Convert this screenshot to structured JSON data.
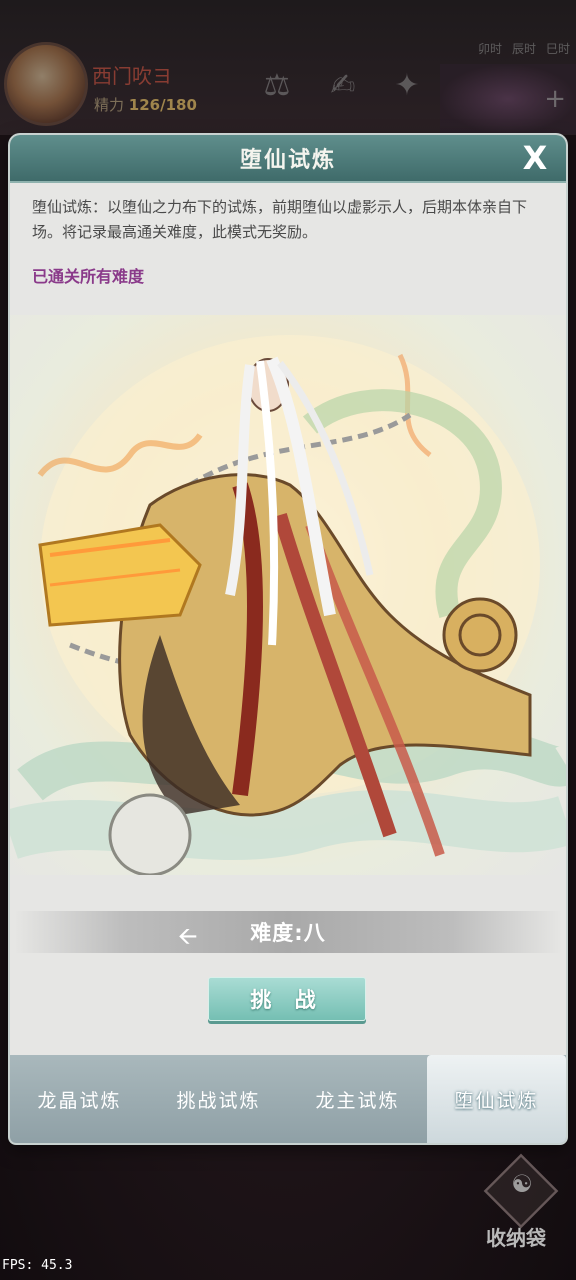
{
  "hud": {
    "player_name": "西门吹ヨ",
    "energy_label": "精力",
    "energy_value": "126/180",
    "time_tabs": [
      "卯时",
      "辰时",
      "巳时"
    ],
    "icons": [
      "bell-icon",
      "scroll-icon",
      "book-icon"
    ]
  },
  "modal": {
    "title": "堕仙试炼",
    "close_symbol": "X",
    "description": "堕仙试炼：以堕仙之力布下的试炼，前期堕仙以虚影示人，后期本体亲自下场。将记录最高通关难度，此模式无奖励。",
    "status": "已通关所有难度",
    "difficulty_label": "难度:八",
    "challenge_button": "挑 战",
    "tabs": [
      {
        "label": "龙晶试炼",
        "active": false
      },
      {
        "label": "挑战试炼",
        "active": false
      },
      {
        "label": "龙主试炼",
        "active": false
      },
      {
        "label": "堕仙试炼",
        "active": true
      }
    ]
  },
  "bag": {
    "label": "收纳袋"
  },
  "fps": "FPS: 45.3",
  "colors": {
    "header": "#4f7c7b",
    "accent_teal": "#8ccbc1",
    "status_purple": "#8a3a8a"
  }
}
